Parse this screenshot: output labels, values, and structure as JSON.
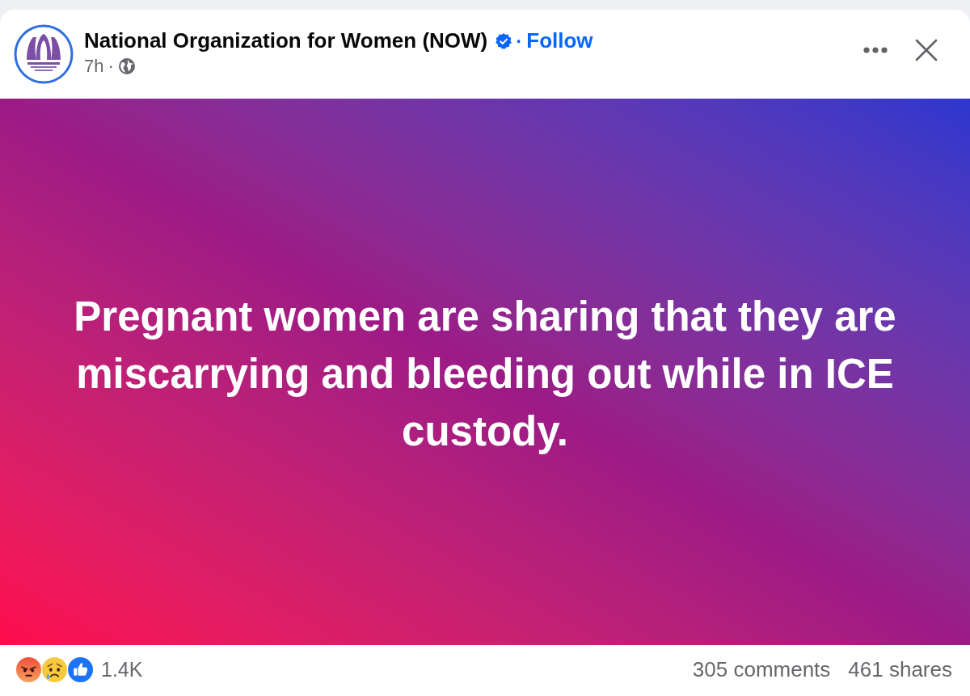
{
  "post": {
    "author": {
      "name": "National Organization for Women (NOW)",
      "verified": true
    },
    "follow": {
      "separator": "·",
      "label": "Follow"
    },
    "timestamp": "7h",
    "timestamp_separator": "·",
    "body": "Pregnant women are sharing that they are miscarrying and bleeding out while in ICE custody.",
    "reactions": [
      {
        "kind": "angry"
      },
      {
        "kind": "sad"
      },
      {
        "kind": "like"
      }
    ],
    "reaction_count": "1.4K",
    "comments": "305 comments",
    "shares": "461 shares"
  }
}
